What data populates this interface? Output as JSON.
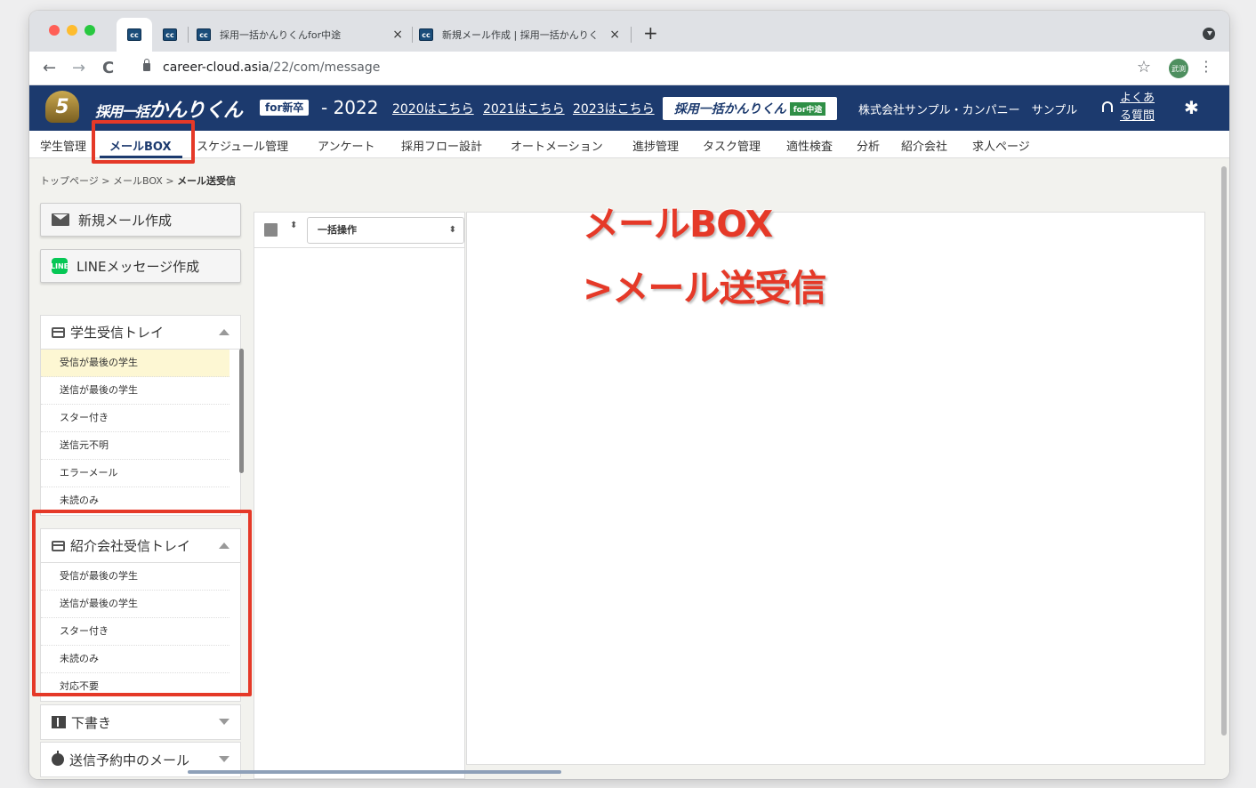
{
  "browser": {
    "tabs": [
      {
        "title": "",
        "favicon": "app-favicon",
        "active": true
      },
      {
        "title": "",
        "favicon": "app-favicon",
        "active": false
      },
      {
        "title": "採用一括かんりくんfor中途",
        "favicon": "app-favicon",
        "active": false
      },
      {
        "title": "新規メール作成 | 採用一括かんりく",
        "favicon": "app-favicon",
        "active": false
      }
    ],
    "tab_close": "×",
    "new_tab": "+",
    "back": "←",
    "forward": "→",
    "reload": "C",
    "url_host": "career-cloud.asia",
    "url_path": "/22/com/message",
    "bookmark_star": "☆",
    "avatar_text": "武渕",
    "menu": "⋮"
  },
  "header": {
    "logo_badge": "5",
    "logo_text_a": "採用一括",
    "logo_text_b": "かんりくん",
    "logo_tag": "for新卒",
    "logo_year": "- 2022",
    "year_links": [
      "2020はこちら",
      "2021はこちら",
      "2023はこちら"
    ],
    "alt_logo_text": "採用一括かんりくん",
    "alt_logo_tag": "for中途",
    "company": "株式会社サンプル・カンパニー　サンプル",
    "faq": "よくある質問",
    "settings_icon": "gear-icon"
  },
  "nav": {
    "items": [
      "学生管理",
      "メールBOX",
      "スケジュール管理",
      "アンケート",
      "採用フロー設計",
      "オートメーション",
      "進捗管理",
      "タスク管理",
      "適性検査",
      "分析",
      "紹介会社",
      "求人ページ"
    ],
    "active_index": 1
  },
  "breadcrumb": {
    "items": [
      "トップページ",
      "メールBOX"
    ],
    "separator": ">",
    "current": "メール送受信"
  },
  "sidebar": {
    "new_mail": "新規メール作成",
    "new_line": "LINEメッセージ作成",
    "line_icon_text": "LINE",
    "student_inbox": {
      "title": "学生受信トレイ",
      "items": [
        "受信が最後の学生",
        "送信が最後の学生",
        "スター付き",
        "送信元不明",
        "エラーメール",
        "未読のみ"
      ]
    },
    "agency_inbox": {
      "title": "紹介会社受信トレイ",
      "items": [
        "受信が最後の学生",
        "送信が最後の学生",
        "スター付き",
        "未読のみ",
        "対応不要"
      ]
    },
    "drafts": "下書き",
    "scheduled": "送信予約中のメール"
  },
  "list": {
    "sort": "⬍",
    "bulk_action": "一括操作",
    "bulk_arrow": "⬍"
  },
  "annotation": {
    "line1": "メールBOX",
    "line2": ">メール送受信"
  },
  "colors": {
    "header_bg": "#1c3a6e",
    "highlight": "#e53928",
    "selected_row": "#fdf7d3",
    "line_green": "#06c755"
  }
}
